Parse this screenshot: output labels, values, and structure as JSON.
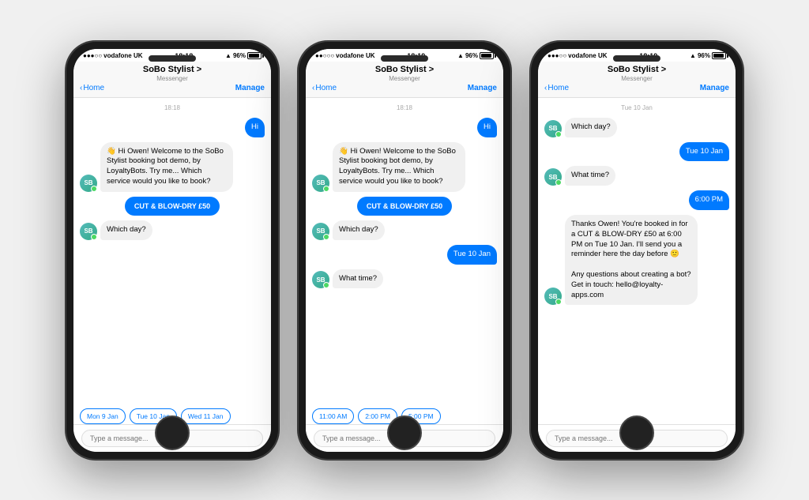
{
  "phones": [
    {
      "id": "phone1",
      "statusBar": {
        "carrier": "●●●○○ vodafone UK",
        "time": "18:18",
        "battery": "96%"
      },
      "nav": {
        "title": "SoBo Stylist >",
        "subtitle": "Messenger",
        "back": "Home",
        "action": "Manage"
      },
      "timestamp": "18:18",
      "messages": [
        {
          "type": "outgoing",
          "text": "Hi"
        },
        {
          "type": "incoming",
          "text": "👋 Hi Owen! Welcome to the SoBo Stylist booking bot demo, by LoyaltyBots. Try me... Which service would you like to book?"
        },
        {
          "type": "action",
          "text": "CUT & BLOW-DRY £50"
        },
        {
          "type": "incoming",
          "text": "Which day?"
        }
      ],
      "chips": [
        "Mon 9 Jan",
        "Tue 10 Jan",
        "Wed 11 Jan"
      ],
      "inputPlaceholder": "Type a message..."
    },
    {
      "id": "phone2",
      "statusBar": {
        "carrier": "●●○○○ vodafone UK",
        "time": "18:19",
        "battery": "96%"
      },
      "nav": {
        "title": "SoBo Stylist >",
        "subtitle": "Messenger",
        "back": "Home",
        "action": "Manage"
      },
      "timestamp": "18:18",
      "messages": [
        {
          "type": "outgoing",
          "text": "Hi"
        },
        {
          "type": "incoming",
          "text": "👋 Hi Owen! Welcome to the SoBo Stylist booking bot demo, by LoyaltyBots. Try me... Which service would you like to book?"
        },
        {
          "type": "action",
          "text": "CUT & BLOW-DRY £50"
        },
        {
          "type": "incoming",
          "text": "Which day?"
        },
        {
          "type": "outgoing",
          "text": "Tue 10 Jan"
        },
        {
          "type": "incoming",
          "text": "What time?"
        }
      ],
      "chips": [
        "11:00 AM",
        "2:00 PM",
        "5:00 PM"
      ],
      "inputPlaceholder": "Type a message..."
    },
    {
      "id": "phone3",
      "statusBar": {
        "carrier": "●●●○○ vodafone UK",
        "time": "18:19",
        "battery": "96%"
      },
      "nav": {
        "title": "SoBo Stylist >",
        "subtitle": "Messenger",
        "back": "Home",
        "action": "Manage"
      },
      "timestamp": "Tue 10 Jan",
      "messages": [
        {
          "type": "incoming",
          "text": "Which day?"
        },
        {
          "type": "outgoing",
          "text": "Tue 10 Jan"
        },
        {
          "type": "incoming",
          "text": "What time?"
        },
        {
          "type": "outgoing",
          "text": "6:00 PM"
        },
        {
          "type": "incoming",
          "text": "Thanks Owen! You're booked in for a CUT & BLOW-DRY £50 at 6:00 PM on Tue 10 Jan. I'll send you a reminder here the day before 🙂\n\nAny questions about creating a bot? Get in touch: hello@loyalty-apps.com"
        }
      ],
      "chips": [],
      "inputPlaceholder": "Type a message..."
    }
  ]
}
